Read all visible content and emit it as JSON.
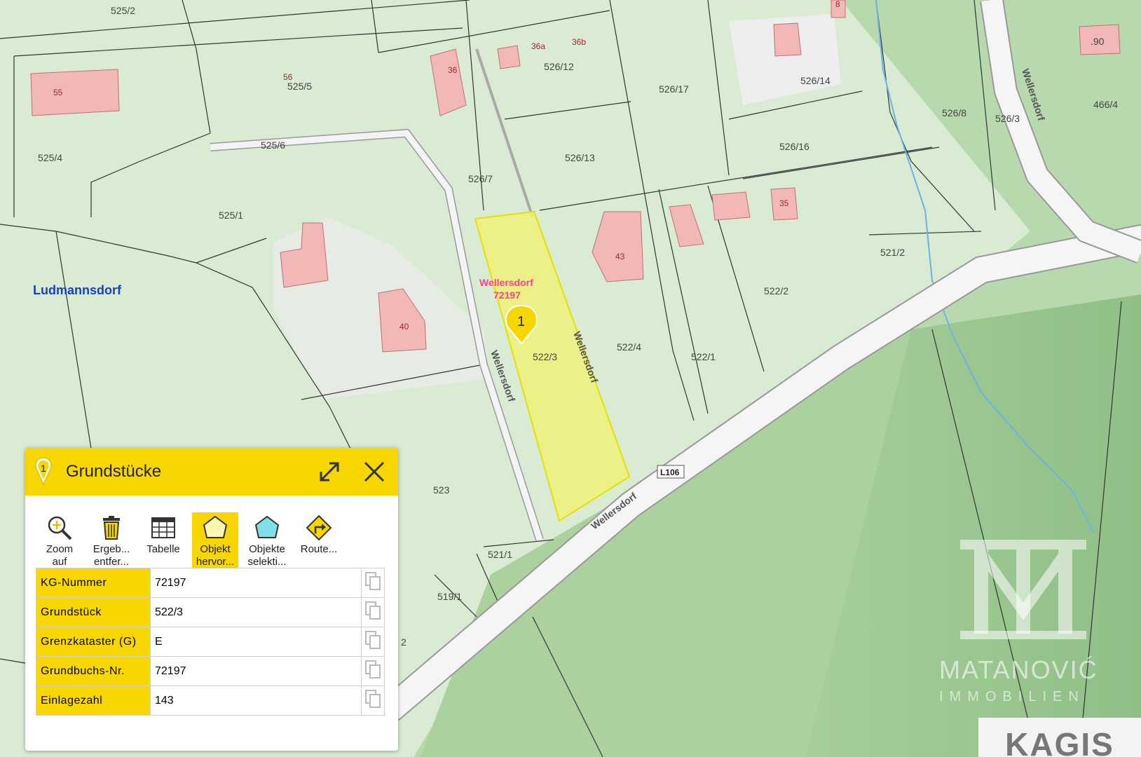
{
  "map": {
    "region_label": "Ludmannsdorf",
    "road_badge": "L106",
    "street_name": "Wellersdorf",
    "selected": {
      "name": "Wellersdorf",
      "code": "72197",
      "marker": "1"
    },
    "parcels": [
      "525/2",
      "525/5",
      "525/4",
      "525/6",
      "525/1",
      "526/12",
      "526/17",
      "526/14",
      "526/8",
      "526/3",
      "466/4",
      "526/16",
      "526/13",
      "526/7",
      "522/3",
      "522/4",
      "522/1",
      "522/2",
      "521/2",
      "523",
      "521/1",
      "519/1",
      "2",
      ".90"
    ],
    "buildings": [
      "55",
      "56",
      "36",
      "36a",
      "36b",
      "8",
      "43",
      "35",
      "40"
    ]
  },
  "panel": {
    "marker": "1",
    "title": "Grundstücke",
    "tools": [
      {
        "line1": "Zoom",
        "line2": "auf",
        "icon": "zoom-in-icon"
      },
      {
        "line1": "Ergeb...",
        "line2": "entfer...",
        "icon": "trash-icon"
      },
      {
        "line1": "Tabelle",
        "line2": "",
        "icon": "table-icon"
      },
      {
        "line1": "Objekt",
        "line2": "hervor...",
        "icon": "highlight-polygon-icon"
      },
      {
        "line1": "Objekte",
        "line2": "selekti...",
        "icon": "select-polygon-icon"
      },
      {
        "line1": "Route...",
        "line2": "",
        "icon": "route-icon"
      }
    ],
    "rows": [
      {
        "key": "KG-Nummer",
        "value": "72197"
      },
      {
        "key": "Grundstück",
        "value": "522/3"
      },
      {
        "key": "Grenzkataster (G)",
        "value": "E"
      },
      {
        "key": "Grundbuchs-Nr.",
        "value": "72197"
      },
      {
        "key": "Einlagezahl",
        "value": "143"
      }
    ]
  },
  "watermark": {
    "brand": "MATANOVIĆ",
    "sub": "IMMOBILIEN"
  },
  "source_badge": "KAGIS",
  "colors": {
    "panel_accent": "#f8d700",
    "highlight": "#eef27a",
    "building": "#f2b8b8",
    "parcel": "#d8ead0"
  }
}
